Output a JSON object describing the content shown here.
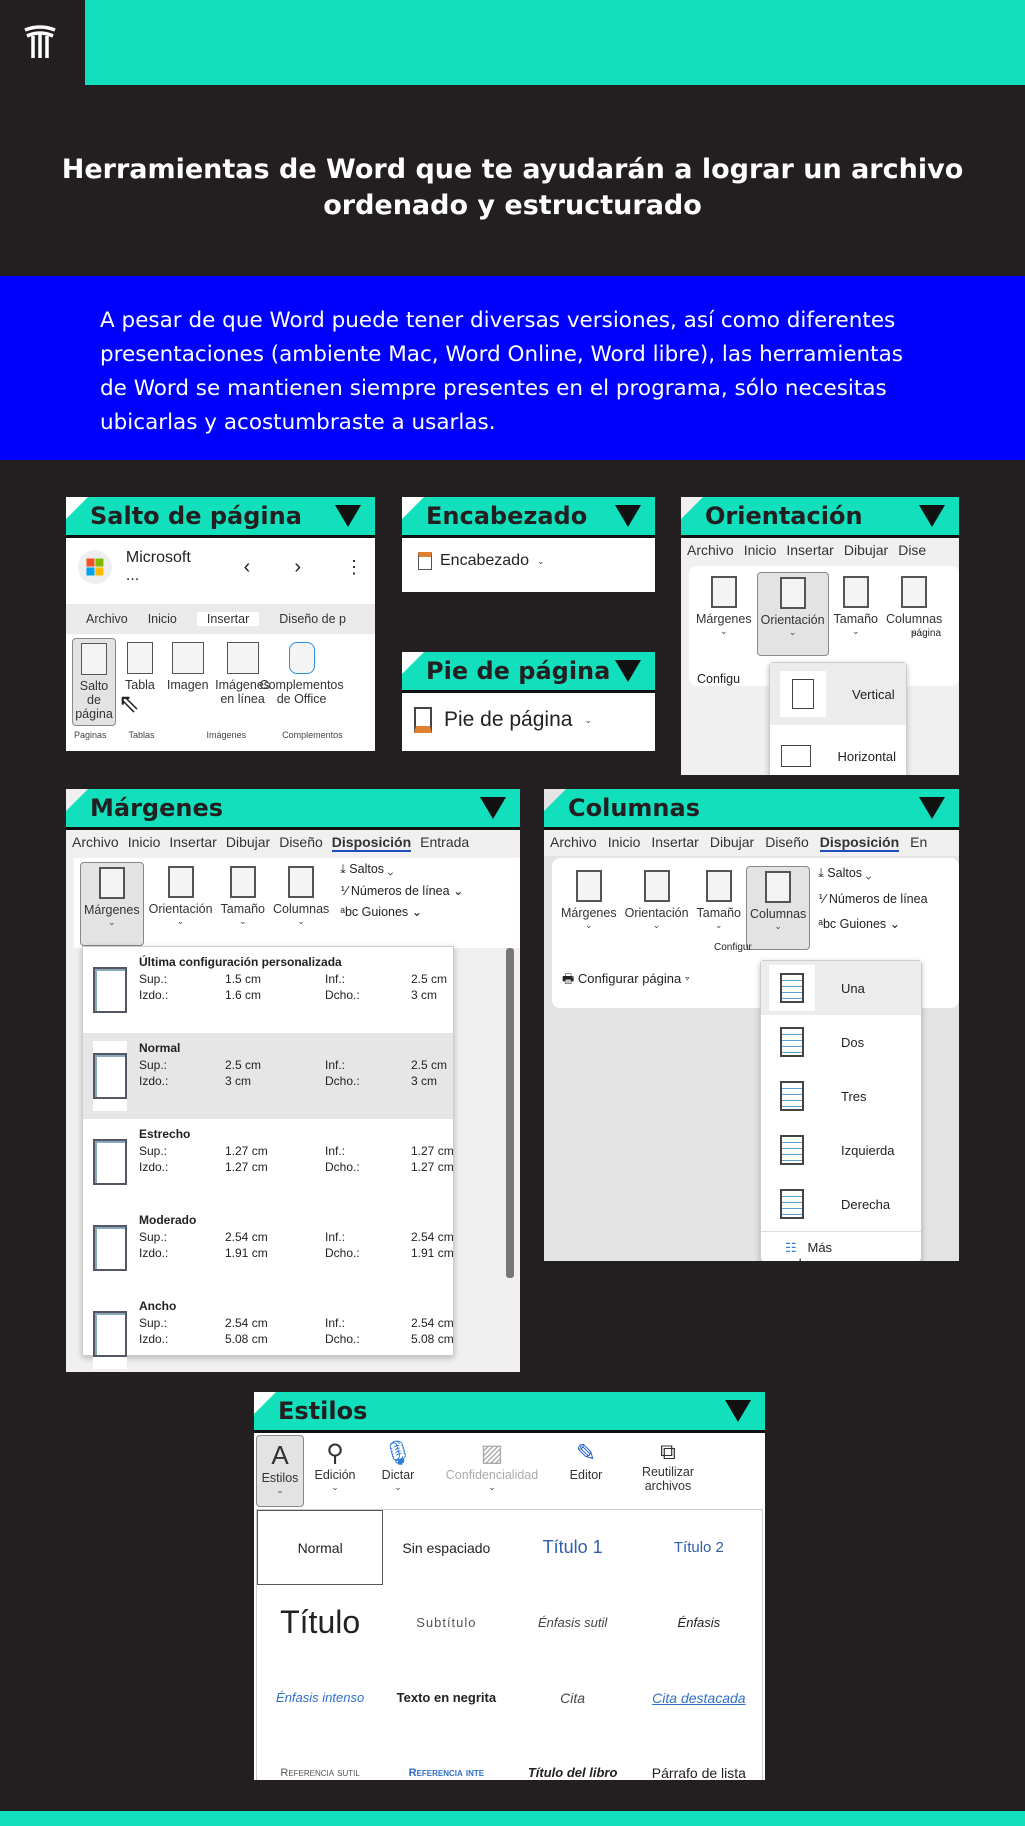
{
  "title": "Herramientas de Word que te ayudarán a lograr un archivo ordenado y estructurado",
  "intro": "A pesar de que Word puede tener diversas versiones, así como diferentes presentaciones (ambiente Mac, Word Online, Word libre), las herramientas de Word se mantienen siempre presentes en el programa, sólo necesitas ubicarlas y acostumbraste a usarlas.",
  "colors": {
    "teal": "#12dfbb",
    "blue": "#0000ff",
    "background": "#231f20"
  },
  "salto": {
    "title": "Salto de página",
    "app": "Microsoft ...",
    "tabs": [
      "Archivo",
      "Inicio",
      "Insertar",
      "Diseño de p"
    ],
    "buttons": [
      "Salto de página",
      "Tabla",
      "Imagen",
      "Imágenes en línea",
      "Complementos de Office"
    ],
    "groups": [
      "Paginas",
      "Tablas",
      "Imágenes",
      "Complementos"
    ]
  },
  "encabezado": {
    "title": "Encabezado",
    "button": "Encabezado"
  },
  "pie": {
    "title": "Pie de página",
    "button": "Pie de página"
  },
  "orientacion": {
    "title": "Orientación",
    "tabs": [
      "Archivo",
      "Inicio",
      "Insertar",
      "Dibujar",
      "Dise"
    ],
    "buttons": [
      "Márgenes",
      "Orientación",
      "Tamaño",
      "Columnas"
    ],
    "group": "página",
    "config": "Configu",
    "options": [
      "Vertical",
      "Horizontal"
    ]
  },
  "margenes": {
    "title": "Márgenes",
    "tabs": [
      "Archivo",
      "Inicio",
      "Insertar",
      "Dibujar",
      "Diseño",
      "Disposición",
      "Entrada"
    ],
    "buttons": [
      "Márgenes",
      "Orientación",
      "Tamaño",
      "Columnas"
    ],
    "side": [
      "Saltos",
      "Números de línea",
      "Guiones"
    ],
    "labels": {
      "sup": "Sup.:",
      "inf": "Inf.:",
      "izdo": "Izdo.:",
      "dcho": "Dcho.:"
    },
    "items": [
      {
        "name": "Última configuración personalizada",
        "sup": "1.5 cm",
        "inf": "2.5 cm",
        "izdo": "1.6 cm",
        "dcho": "3 cm"
      },
      {
        "name": "Normal",
        "sup": "2.5 cm",
        "inf": "2.5 cm",
        "izdo": "3 cm",
        "dcho": "3 cm"
      },
      {
        "name": "Estrecho",
        "sup": "1.27 cm",
        "inf": "1.27 cm",
        "izdo": "1.27 cm",
        "dcho": "1.27 cm"
      },
      {
        "name": "Moderado",
        "sup": "2.54 cm",
        "inf": "2.54 cm",
        "izdo": "1.91 cm",
        "dcho": "1.91 cm"
      },
      {
        "name": "Ancho",
        "sup": "2.54 cm",
        "inf": "2.54 cm",
        "izdo": "5.08 cm",
        "dcho": "5.08 cm"
      }
    ]
  },
  "columnas": {
    "title": "Columnas",
    "tabs": [
      "Archivo",
      "Inicio",
      "Insertar",
      "Dibujar",
      "Diseño",
      "Disposición",
      "En"
    ],
    "buttons": [
      "Márgenes",
      "Orientación",
      "Tamaño",
      "Columnas"
    ],
    "side": [
      "Saltos",
      "Números de línea",
      "Guiones"
    ],
    "group": "Configur",
    "config": "Configurar página",
    "options": [
      "Una",
      "Dos",
      "Tres",
      "Izquierda",
      "Derecha"
    ],
    "more": "Más columnas..."
  },
  "estilos": {
    "title": "Estilos",
    "buttons": [
      "Estilos",
      "Edición",
      "Dictar",
      "Confidencialidad",
      "Editor",
      "Reutilizar archivos"
    ],
    "gallery": [
      "Normal",
      "Sin espaciado",
      "Título 1",
      "Título 2",
      "Título",
      "Subtítulo",
      "Énfasis sutil",
      "Énfasis",
      "Énfasis intenso",
      "Texto en negrita",
      "Cita",
      "Cita destacada",
      "Referencia sutil",
      "Referencia inte",
      "Título del libro",
      "Párrafo de lista"
    ]
  }
}
